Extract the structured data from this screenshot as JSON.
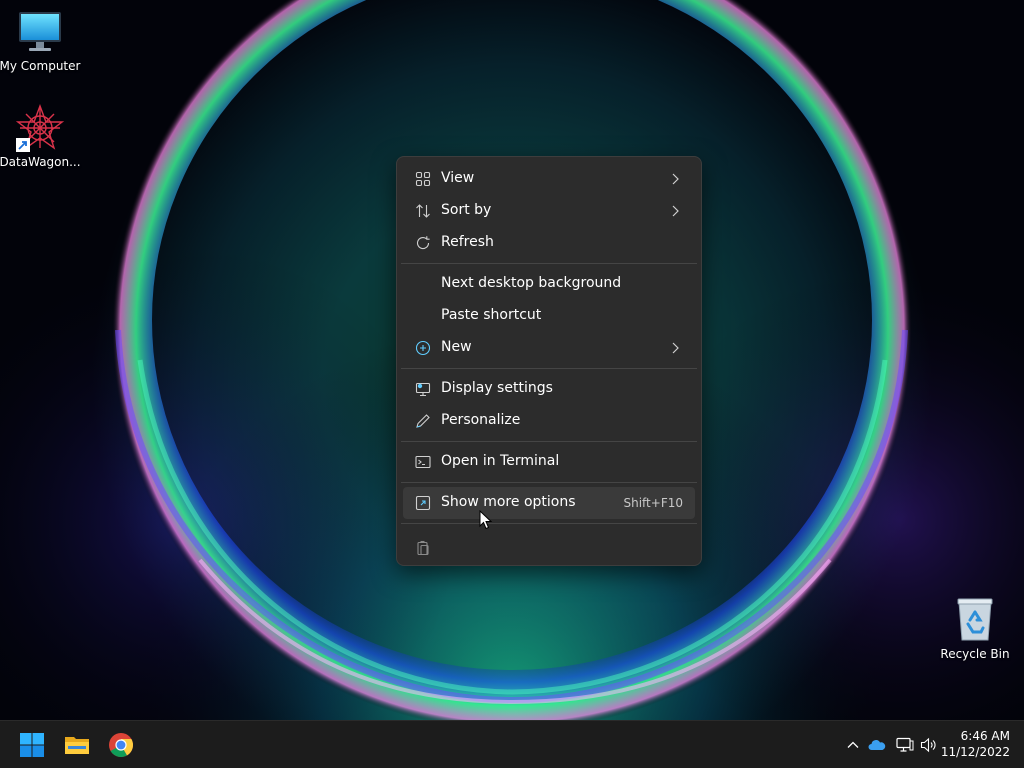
{
  "desktop": {
    "icons": [
      {
        "label": "My Computer",
        "icon": "monitor-icon"
      },
      {
        "label": "DataWagon...",
        "icon": "datawagon-icon"
      },
      {
        "label": "Recycle Bin",
        "icon": "recycle-bin-icon"
      }
    ]
  },
  "context_menu": {
    "items": [
      {
        "label": "View",
        "icon": "grid-icon",
        "submenu": true
      },
      {
        "label": "Sort by",
        "icon": "sort-icon",
        "submenu": true
      },
      {
        "label": "Refresh",
        "icon": "refresh-icon"
      },
      {
        "label": "Next desktop background"
      },
      {
        "label": "Paste shortcut"
      },
      {
        "label": "New",
        "icon": "plus-circle-icon",
        "submenu": true
      },
      {
        "label": "Display settings",
        "icon": "display-settings-icon"
      },
      {
        "label": "Personalize",
        "icon": "pen-icon"
      },
      {
        "label": "Open in Terminal",
        "icon": "terminal-icon"
      },
      {
        "label": "Show more options",
        "icon": "more-options-icon",
        "accelerator": "Shift+F10",
        "highlighted": true
      }
    ],
    "bottom_icon": "paste-icon"
  },
  "taskbar": {
    "apps": [
      "windows-start-icon",
      "file-explorer-icon",
      "chrome-icon"
    ],
    "tray": [
      "chevron-up-icon",
      "onedrive-icon",
      "network-icon",
      "volume-icon"
    ],
    "clock": {
      "time": "6:46 AM",
      "date": "11/12/2022"
    }
  },
  "colors": {
    "menu_bg": "#2c2c2c",
    "menu_hover": "#3a3a3a",
    "accent_blue": "#60cdff",
    "taskbar_bg": "#1c1c1c"
  }
}
